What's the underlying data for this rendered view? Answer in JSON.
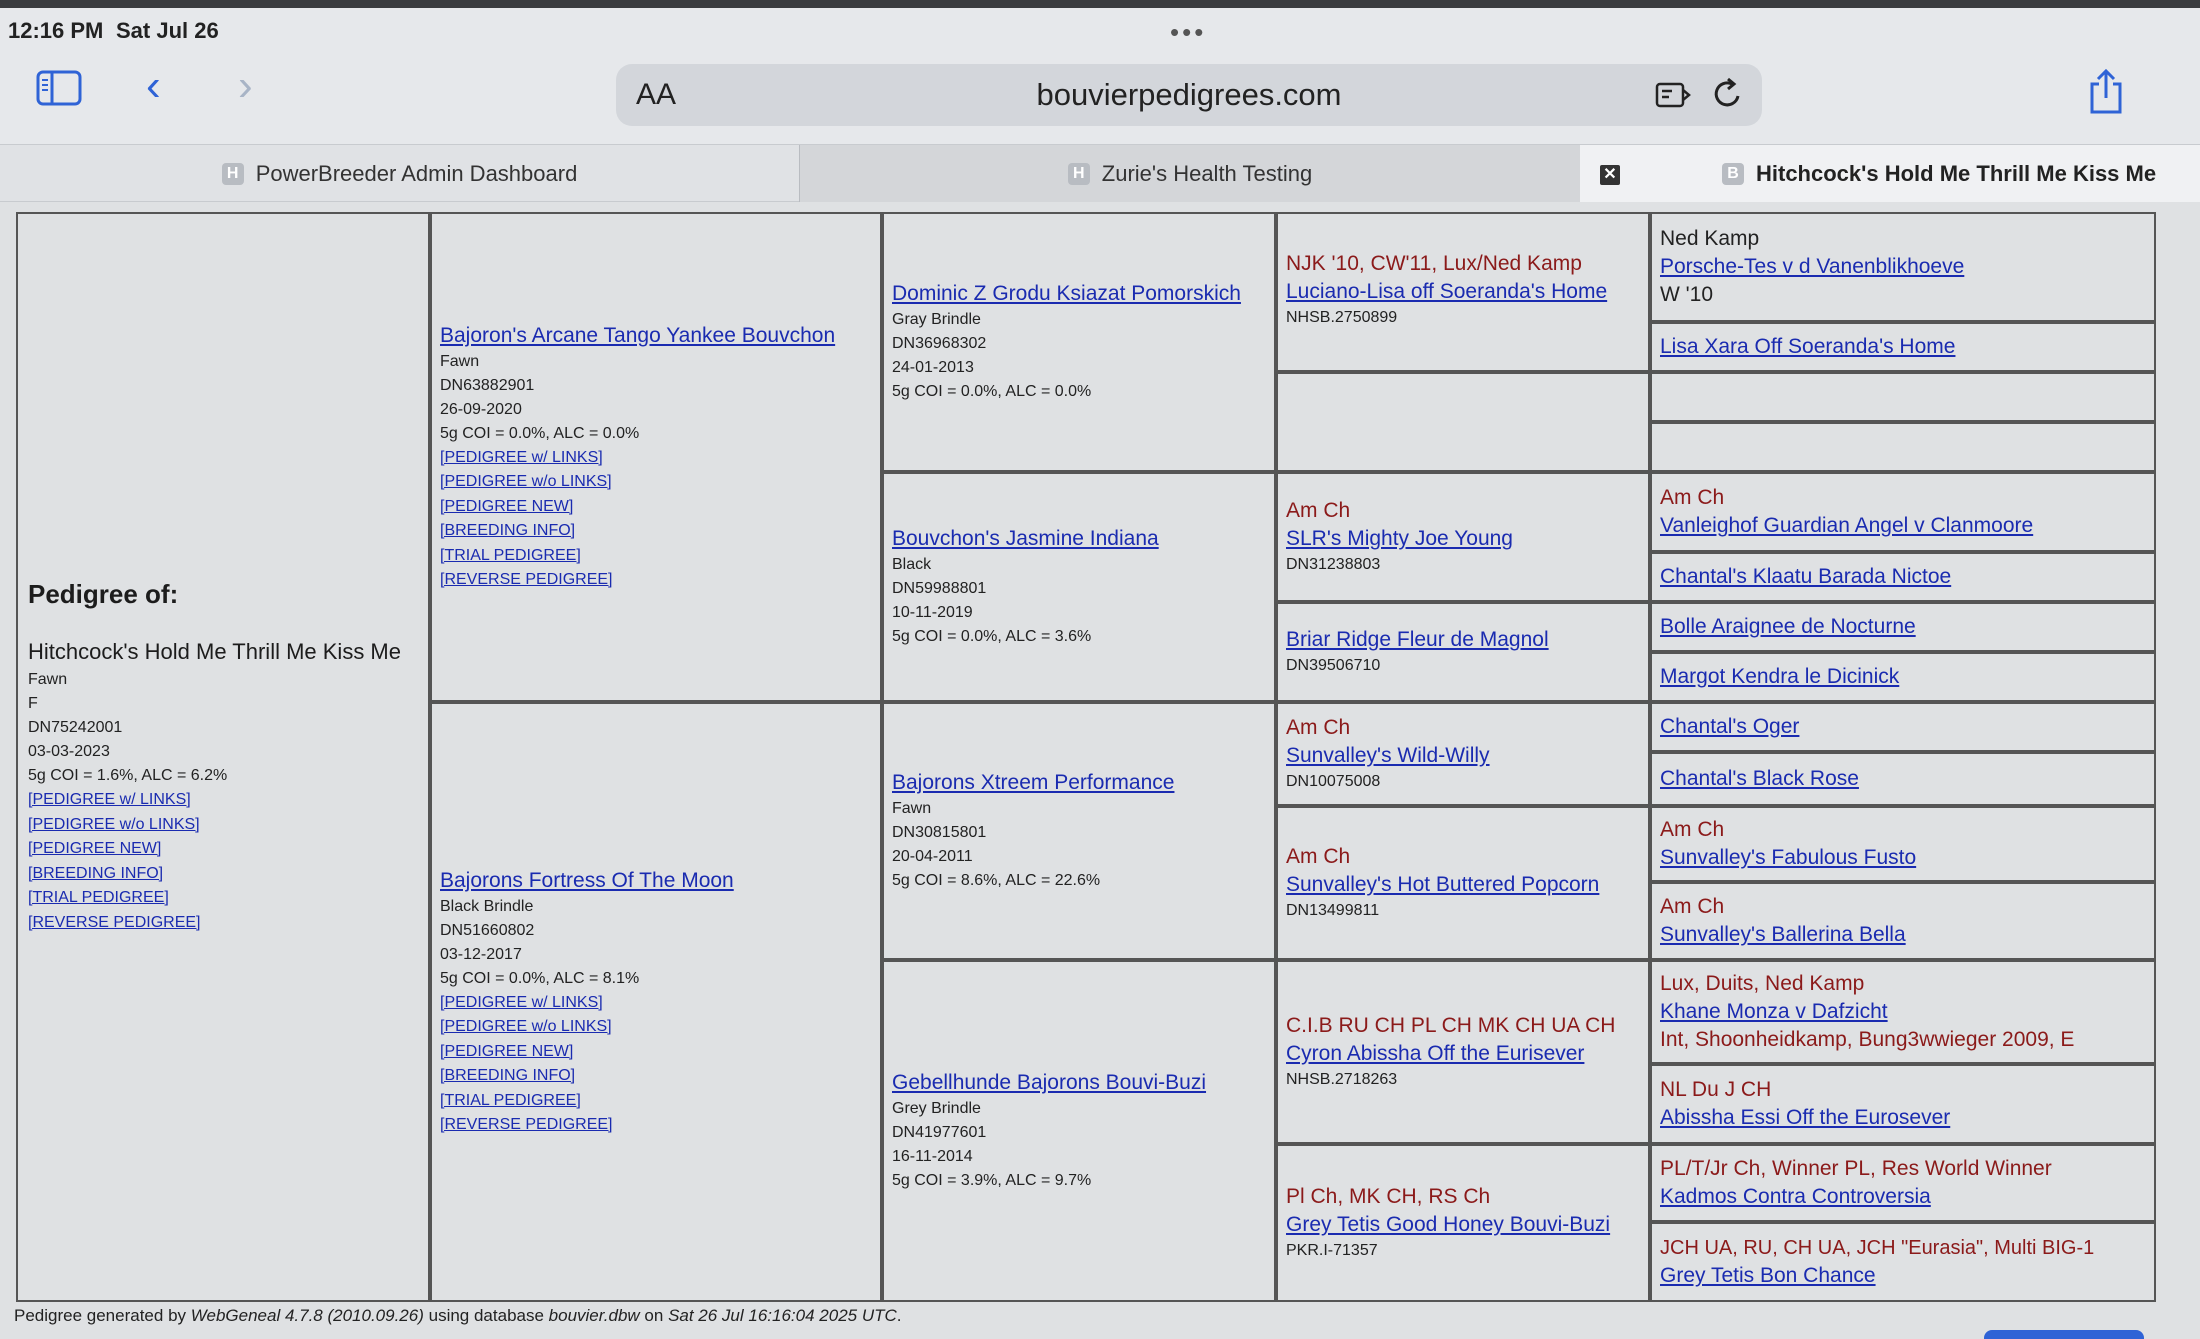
{
  "status": {
    "time": "12:16 PM",
    "date": "Sat Jul 26",
    "dots": "•••"
  },
  "toolbar": {
    "aa": "AA",
    "url": "bouvierpedigrees.com"
  },
  "icons": {
    "sidebar": "sidebar-icon",
    "back": "chevron-left-icon",
    "forward": "chevron-right-icon",
    "reader": "reader-icon",
    "reload": "reload-icon",
    "share": "share-icon",
    "close": "close-icon"
  },
  "tabs": [
    {
      "favicon": "H",
      "label": "PowerBreeder Admin Dashboard"
    },
    {
      "favicon": "H",
      "label": "Zurie's Health Testing"
    },
    {
      "favicon": "B",
      "label": "Hitchcock's Hold Me Thrill Me Kiss Me",
      "close": "✕"
    }
  ],
  "subject": {
    "heading": "Pedigree of:",
    "name": "Hitchcock's Hold Me Thrill Me Kiss Me",
    "info": [
      "Fawn",
      "F",
      "DN75242001",
      "03-03-2023",
      "5g COI = 1.6%, ALC = 6.2%"
    ],
    "links": [
      "[PEDIGREE w/ LINKS]",
      "[PEDIGREE w/o LINKS]",
      "[PEDIGREE NEW]",
      "[BREEDING INFO]",
      "[TRIAL PEDIGREE]",
      "[REVERSE PEDIGREE]"
    ]
  },
  "parents": [
    {
      "name": "Bajoron's Arcane Tango Yankee Bouvchon",
      "info": [
        "Fawn",
        "DN63882901",
        "26-09-2020",
        "5g COI = 0.0%, ALC = 0.0%"
      ],
      "links": [
        "[PEDIGREE w/ LINKS]",
        "[PEDIGREE w/o LINKS]",
        "[PEDIGREE NEW]",
        "[BREEDING INFO]",
        "[TRIAL PEDIGREE]",
        "[REVERSE PEDIGREE]"
      ]
    },
    {
      "name": "Bajorons Fortress Of The Moon",
      "info": [
        "Black Brindle",
        "DN51660802",
        "03-12-2017",
        "5g COI = 0.0%, ALC = 8.1%"
      ],
      "links": [
        "[PEDIGREE w/ LINKS]",
        "[PEDIGREE w/o LINKS]",
        "[PEDIGREE NEW]",
        "[BREEDING INFO]",
        "[TRIAL PEDIGREE]",
        "[REVERSE PEDIGREE]"
      ]
    }
  ],
  "grandparents": [
    {
      "name": "Dominic Z Grodu Ksiazat Pomorskich",
      "info": [
        "Gray Brindle",
        "DN36968302",
        "24-01-2013",
        "5g COI = 0.0%, ALC = 0.0%"
      ]
    },
    {
      "name": "Bouvchon's Jasmine Indiana",
      "info": [
        "Black",
        "DN59988801",
        "10-11-2019",
        "5g COI = 0.0%, ALC = 3.6%"
      ]
    },
    {
      "name": "Bajorons Xtreem Performance",
      "info": [
        "Fawn",
        "DN30815801",
        "20-04-2011",
        "5g COI = 8.6%, ALC = 22.6%"
      ]
    },
    {
      "name": "Gebellhunde Bajorons Bouvi-Buzi",
      "info": [
        "Grey Brindle",
        "DN41977601",
        "16-11-2014",
        "5g COI = 3.9%, ALC = 9.7%"
      ]
    }
  ],
  "greatgrandparents": [
    {
      "title": "NJK '10, CW'11, Lux/Ned Kamp",
      "name": "Luciano-Lisa off Soeranda's Home",
      "info": "NHSB.2750899"
    },
    {
      "title": "",
      "name": "",
      "info": ""
    },
    {
      "title": "Am Ch",
      "name": "SLR's Mighty Joe Young",
      "info": "DN31238803"
    },
    {
      "title": "",
      "name": "Briar Ridge Fleur de Magnol",
      "info": "DN39506710"
    },
    {
      "title": "Am Ch",
      "name": "Sunvalley's Wild-Willy",
      "info": "DN10075008"
    },
    {
      "title": "Am Ch",
      "name": "Sunvalley's Hot Buttered Popcorn",
      "info": "DN13499811"
    },
    {
      "title": "C.I.B RU CH PL CH MK CH UA CH",
      "name": "Cyron Abissha Off the Eurisever",
      "info": "NHSB.2718263"
    },
    {
      "title": "Pl Ch, MK CH, RS Ch",
      "name": "Grey Tetis Good Honey Bouvi-Buzi",
      "info": "PKR.I-71357"
    }
  ],
  "gen4": [
    {
      "title": "Ned Kamp",
      "name": "Porsche-Tes v d Vanenblikhoeve",
      "title2": "W '10"
    },
    {
      "title": "",
      "name": "Lisa Xara Off Soeranda's Home",
      "title2": ""
    },
    {
      "title": "",
      "name": "",
      "title2": ""
    },
    {
      "title": "",
      "name": "",
      "title2": ""
    },
    {
      "title": "Am Ch",
      "name": "Vanleighof Guardian Angel v Clanmoore",
      "title2": ""
    },
    {
      "title": "",
      "name": "Chantal's Klaatu Barada Nictoe",
      "title2": ""
    },
    {
      "title": "",
      "name": "Bolle Araignee de Nocturne",
      "title2": ""
    },
    {
      "title": "",
      "name": "Margot Kendra le Dicinick",
      "title2": ""
    },
    {
      "title": "",
      "name": "Chantal's Oger",
      "title2": ""
    },
    {
      "title": "",
      "name": "Chantal's Black Rose",
      "title2": ""
    },
    {
      "title": "Am Ch",
      "name": "Sunvalley's Fabulous Fusto",
      "title2": ""
    },
    {
      "title": "Am Ch",
      "name": "Sunvalley's Ballerina Bella",
      "title2": ""
    },
    {
      "title": "Lux, Duits, Ned Kamp",
      "name": "Khane Monza v Dafzicht",
      "title2": "Int, Shoonheidkamp, Bung3wwieger 2009, E"
    },
    {
      "title": "NL Du J CH",
      "name": "Abissha Essi Off the Eurosever",
      "title2": ""
    },
    {
      "title": "PL/T/Jr Ch, Winner PL, Res World Winner",
      "name": "Kadmos Contra Controversia",
      "title2": ""
    },
    {
      "title": "JCH UA, RU, CH UA, JCH \"Eurasia\", Multi BIG-1",
      "name": "Grey Tetis Bon Chance",
      "title2": ""
    }
  ],
  "footer": {
    "prefix": "Pedigree generated by ",
    "software": "WebGeneal 4.7.8 (2010.09.26)",
    "mid": " using database ",
    "db": "bouvier.dbw",
    "on": " on ",
    "date": "Sat 26 Jul 16:16:04 2025 UTC",
    "end": "."
  }
}
